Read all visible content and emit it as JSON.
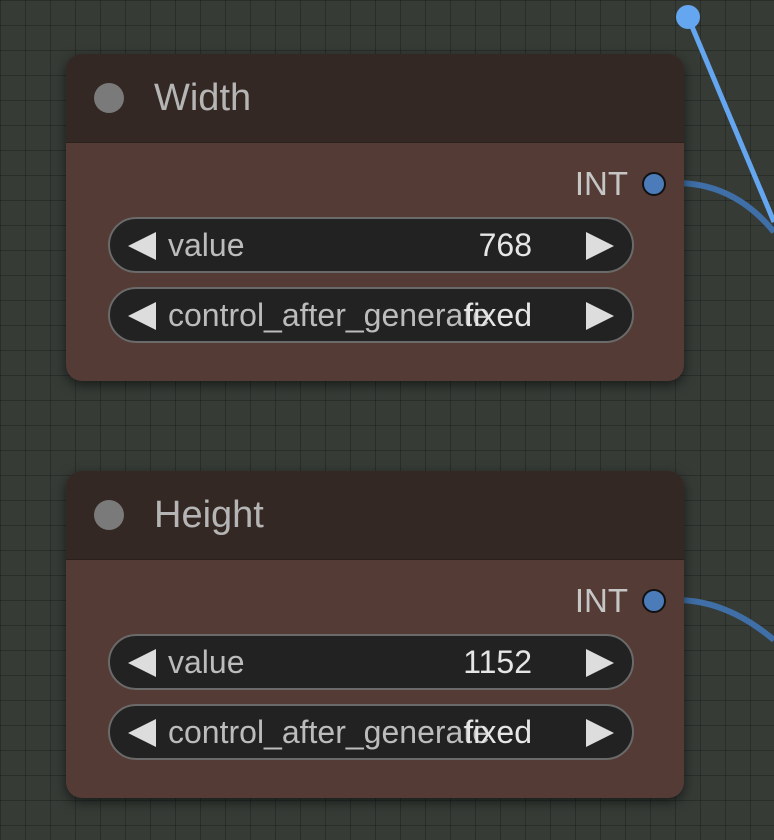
{
  "nodes": [
    {
      "title": "Width",
      "output": "INT",
      "widgets": [
        {
          "label": "value",
          "value": "768"
        },
        {
          "label": "control_after_generate",
          "value": "fixed"
        }
      ]
    },
    {
      "title": "Height",
      "output": "INT",
      "widgets": [
        {
          "label": "value",
          "value": "1152"
        },
        {
          "label": "control_after_generate",
          "value": "fixed"
        }
      ]
    }
  ],
  "colors": {
    "canvas": "#363b36",
    "node_body": "#553b35",
    "node_header": "#332823",
    "link_int": "#4b7bb8",
    "link_selected": "#64a6f0"
  }
}
